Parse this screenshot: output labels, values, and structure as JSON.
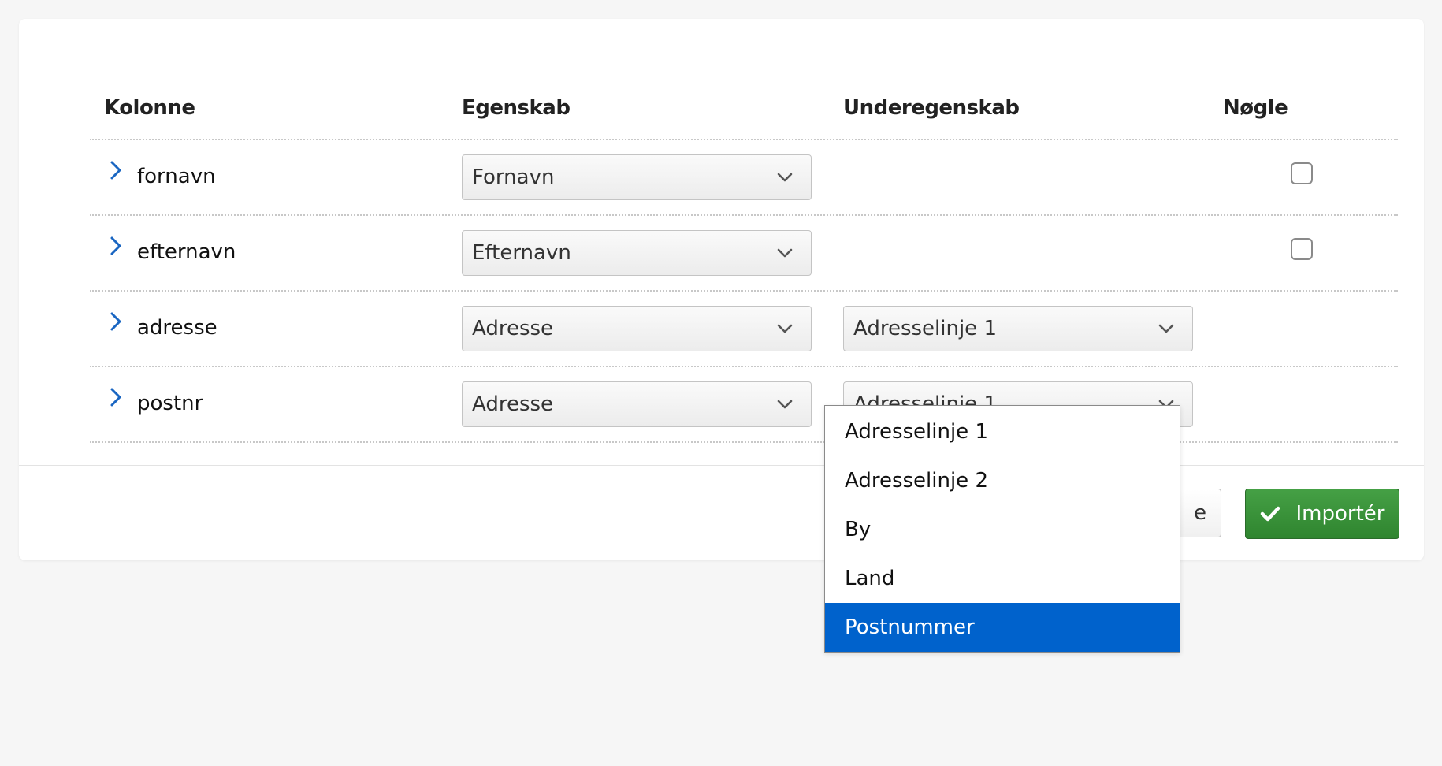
{
  "table": {
    "headers": {
      "column": "Kolonne",
      "property": "Egenskab",
      "subproperty": "Underegenskab",
      "key": "Nøgle"
    },
    "rows": [
      {
        "column": "fornavn",
        "property": "Fornavn",
        "subproperty": null,
        "key_checked": false
      },
      {
        "column": "efternavn",
        "property": "Efternavn",
        "subproperty": null,
        "key_checked": false
      },
      {
        "column": "adresse",
        "property": "Adresse",
        "subproperty": "Adresselinje 1"
      },
      {
        "column": "postnr",
        "property": "Adresse",
        "subproperty": "Adresselinje 1"
      }
    ]
  },
  "dropdown": {
    "options": [
      "Adresselinje 1",
      "Adresselinje 2",
      "By",
      "Land",
      "Postnummer"
    ],
    "highlighted": "Postnummer"
  },
  "footer": {
    "secondary_button_label": "e",
    "import_button_label": "Importér"
  },
  "icons": {
    "row_expand": "chevron-right-icon",
    "select_caret": "chevron-down-icon",
    "import": "check-icon"
  },
  "colors": {
    "accent_blue": "#0062cc",
    "chevron_blue": "#1a66c2",
    "import_green": "#3a943a",
    "page_background": "#f6f6f6",
    "card_background": "#ffffff"
  }
}
